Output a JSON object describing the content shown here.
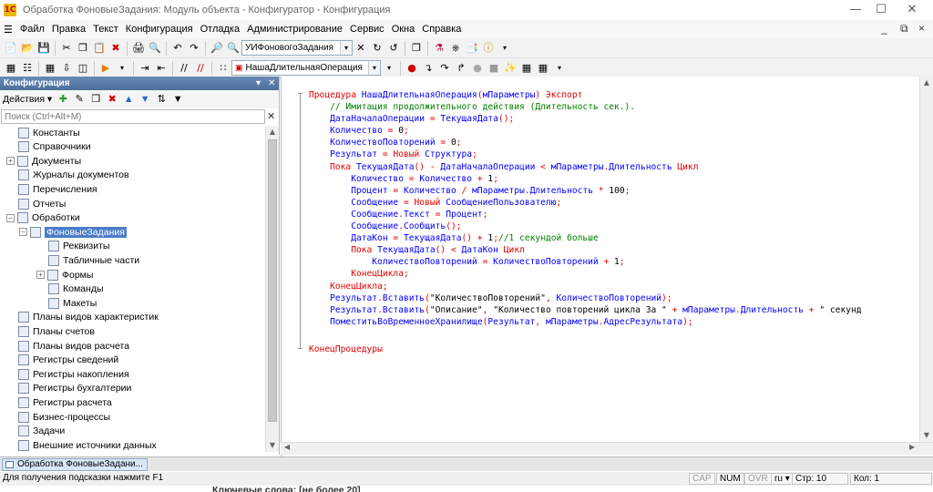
{
  "window": {
    "title": "Обработка ФоновыеЗадания: Модуль объекта - Конфигуратор - Конфигурация",
    "icon": "1c-icon",
    "controls": [
      "minimize-icon",
      "maximize-icon",
      "close-icon"
    ]
  },
  "menu": {
    "items": [
      "Файл",
      "Правка",
      "Текст",
      "Конфигурация",
      "Отладка",
      "Администрирование",
      "Сервис",
      "Окна",
      "Справка"
    ],
    "mdi_controls": [
      "_",
      "⧉",
      "×"
    ]
  },
  "toolbar1": {
    "search_combo": "УИФоновогоЗадания",
    "search_dropdown": "▾"
  },
  "toolbar2": {
    "proc_combo": "НашаДлительнаяОперация",
    "proc_dropdown": "▾"
  },
  "panel": {
    "header": "Конфигурация",
    "actions_label": "Действия",
    "search_placeholder": "Поиск (Ctrl+Alt+M)",
    "tree": [
      {
        "label": "Константы",
        "level": 0,
        "icon": "constant-icon"
      },
      {
        "label": "Справочники",
        "level": 0,
        "icon": "catalog-icon"
      },
      {
        "label": "Документы",
        "level": 0,
        "icon": "document-icon",
        "expander": "+"
      },
      {
        "label": "Журналы документов",
        "level": 0,
        "icon": "journal-icon"
      },
      {
        "label": "Перечисления",
        "level": 0,
        "icon": "enum-icon"
      },
      {
        "label": "Отчеты",
        "level": 0,
        "icon": "report-icon"
      },
      {
        "label": "Обработки",
        "level": 0,
        "icon": "dataprocessor-icon",
        "expander": "−"
      },
      {
        "label": "ФоновыеЗадания",
        "level": 1,
        "icon": "dataprocessor-icon",
        "expander": "−",
        "selected": true
      },
      {
        "label": "Реквизиты",
        "level": 2,
        "icon": "attribute-icon"
      },
      {
        "label": "Табличные части",
        "level": 2,
        "icon": "tabular-icon"
      },
      {
        "label": "Формы",
        "level": 2,
        "icon": "form-icon",
        "expander": "+"
      },
      {
        "label": "Команды",
        "level": 2,
        "icon": "command-icon"
      },
      {
        "label": "Макеты",
        "level": 2,
        "icon": "template-icon"
      },
      {
        "label": "Планы видов характеристик",
        "level": 0,
        "icon": "chart-of-char-icon"
      },
      {
        "label": "Планы счетов",
        "level": 0,
        "icon": "chart-of-accounts-icon"
      },
      {
        "label": "Планы видов расчета",
        "level": 0,
        "icon": "chart-of-calc-icon"
      },
      {
        "label": "Регистры сведений",
        "level": 0,
        "icon": "info-register-icon"
      },
      {
        "label": "Регистры накопления",
        "level": 0,
        "icon": "accum-register-icon"
      },
      {
        "label": "Регистры бухгалтерии",
        "level": 0,
        "icon": "acc-register-icon"
      },
      {
        "label": "Регистры расчета",
        "level": 0,
        "icon": "calc-register-icon"
      },
      {
        "label": "Бизнес-процессы",
        "level": 0,
        "icon": "business-process-icon"
      },
      {
        "label": "Задачи",
        "level": 0,
        "icon": "task-icon"
      },
      {
        "label": "Внешние источники данных",
        "level": 0,
        "icon": "external-source-icon"
      }
    ]
  },
  "code": {
    "lines": [
      [
        [
          "kw",
          "Процедура "
        ],
        [
          "id",
          "НашаДлительнаяОперация"
        ],
        [
          "op",
          "("
        ],
        [
          "id",
          "мПараметры"
        ],
        [
          "op",
          ") "
        ],
        [
          "kw",
          "Экспорт"
        ]
      ],
      [
        [
          "cm",
          "    // Имитация продолжительного действия (Длительность сек.)."
        ]
      ],
      [
        [
          "id",
          "    ДатаНачалаОперации "
        ],
        [
          "op",
          "= "
        ],
        [
          "id",
          "ТекущаяДата"
        ],
        [
          "op",
          "();"
        ]
      ],
      [
        [
          "id",
          "    Количество "
        ],
        [
          "op",
          "= "
        ],
        [
          "num",
          "0"
        ],
        [
          "op",
          ";"
        ]
      ],
      [
        [
          "id",
          "    КоличествоПовторений "
        ],
        [
          "op",
          "= "
        ],
        [
          "num",
          "0"
        ],
        [
          "op",
          ";"
        ]
      ],
      [
        [
          "id",
          "    Результат "
        ],
        [
          "op",
          "= "
        ],
        [
          "kw",
          "Новый "
        ],
        [
          "id",
          "Структура"
        ],
        [
          "op",
          ";"
        ]
      ],
      [
        [
          "kw",
          "    Пока "
        ],
        [
          "id",
          "ТекущаяДата"
        ],
        [
          "op",
          "() - "
        ],
        [
          "id",
          "ДатаНачалаОперации "
        ],
        [
          "op",
          "< "
        ],
        [
          "id",
          "мПараметры"
        ],
        [
          "op",
          "."
        ],
        [
          "id",
          "Длительность "
        ],
        [
          "kw",
          "Цикл"
        ]
      ],
      [
        [
          "id",
          "        Количество "
        ],
        [
          "op",
          "= "
        ],
        [
          "id",
          "Количество "
        ],
        [
          "op",
          "+ "
        ],
        [
          "num",
          "1"
        ],
        [
          "op",
          ";"
        ]
      ],
      [
        [
          "id",
          "        Процент "
        ],
        [
          "op",
          "= "
        ],
        [
          "id",
          "Количество "
        ],
        [
          "op",
          "/ "
        ],
        [
          "id",
          "мПараметры"
        ],
        [
          "op",
          "."
        ],
        [
          "id",
          "Длительность "
        ],
        [
          "op",
          "* "
        ],
        [
          "num",
          "100"
        ],
        [
          "op",
          ";"
        ]
      ],
      [
        [
          "id",
          "        Сообщение "
        ],
        [
          "op",
          "= "
        ],
        [
          "kw",
          "Новый "
        ],
        [
          "id",
          "СообщениеПользователю"
        ],
        [
          "op",
          ";"
        ]
      ],
      [
        [
          "id",
          "        Сообщение"
        ],
        [
          "op",
          "."
        ],
        [
          "id",
          "Текст "
        ],
        [
          "op",
          "= "
        ],
        [
          "id",
          "Процент"
        ],
        [
          "op",
          ";"
        ]
      ],
      [
        [
          "id",
          "        Сообщение"
        ],
        [
          "op",
          "."
        ],
        [
          "id",
          "Сообщить"
        ],
        [
          "op",
          "();"
        ]
      ],
      [
        [
          "id",
          "        ДатаКон "
        ],
        [
          "op",
          "= "
        ],
        [
          "id",
          "ТекущаяДата"
        ],
        [
          "op",
          "() + "
        ],
        [
          "num",
          "1"
        ],
        [
          "op",
          ";"
        ],
        [
          "cm",
          "//1 секундой больше"
        ]
      ],
      [
        [
          "kw",
          "        Пока "
        ],
        [
          "id",
          "ТекущаяДата"
        ],
        [
          "op",
          "() < "
        ],
        [
          "id",
          "ДатаКон "
        ],
        [
          "kw",
          "Цикл"
        ]
      ],
      [
        [
          "id",
          "            КоличествоПовторений "
        ],
        [
          "op",
          "= "
        ],
        [
          "id",
          "КоличествоПовторений "
        ],
        [
          "op",
          "+ "
        ],
        [
          "num",
          "1"
        ],
        [
          "op",
          ";"
        ]
      ],
      [
        [
          "kw",
          "        КонецЦикла"
        ],
        [
          "op",
          ";"
        ]
      ],
      [
        [
          "kw",
          "    КонецЦикла"
        ],
        [
          "op",
          ";"
        ]
      ],
      [
        [
          "id",
          "    Результат"
        ],
        [
          "op",
          "."
        ],
        [
          "id",
          "Вставить"
        ],
        [
          "op",
          "("
        ],
        [
          "str",
          "\"КоличествоПовторений\""
        ],
        [
          "op",
          ", "
        ],
        [
          "id",
          "КоличествоПовторений"
        ],
        [
          "op",
          ");"
        ]
      ],
      [
        [
          "id",
          "    Результат"
        ],
        [
          "op",
          "."
        ],
        [
          "id",
          "Вставить"
        ],
        [
          "op",
          "("
        ],
        [
          "str",
          "\"Описание\""
        ],
        [
          "op",
          ", "
        ],
        [
          "str",
          "\"Количество повторений цикла За \" "
        ],
        [
          "op",
          "+ "
        ],
        [
          "id",
          "мПараметры"
        ],
        [
          "op",
          "."
        ],
        [
          "id",
          "Длительность "
        ],
        [
          "op",
          "+ "
        ],
        [
          "str",
          "\" секунд"
        ]
      ],
      [
        [
          "id",
          "    ПоместитьВоВременноеХранилище"
        ],
        [
          "op",
          "("
        ],
        [
          "id",
          "Результат"
        ],
        [
          "op",
          ", "
        ],
        [
          "id",
          "мПараметры"
        ],
        [
          "op",
          "."
        ],
        [
          "id",
          "АдресРезультата"
        ],
        [
          "op",
          ");"
        ]
      ],
      [],
      [
        [
          "kw",
          "КонецПроцедуры"
        ]
      ]
    ]
  },
  "taskbar": {
    "item": "Обработка ФоновыеЗадани..."
  },
  "status": {
    "hint": "Для получения подсказки нажмите F1",
    "cap": "CAP",
    "num": "NUM",
    "ovr": "OVR",
    "lang": "ru",
    "lang_arrow": "▾",
    "row": "Стр: 10",
    "col": "Кол: 1"
  },
  "behind_text": "Ключевые слова: [не более 20]"
}
